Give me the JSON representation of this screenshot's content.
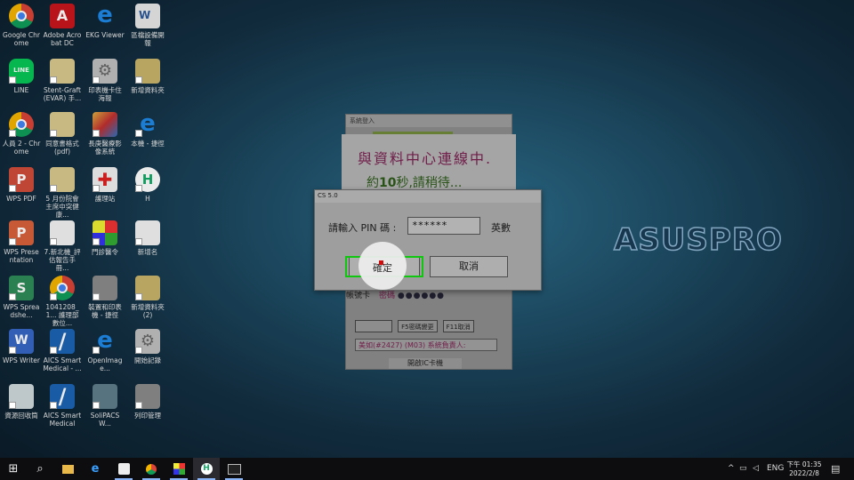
{
  "desktop_icons": [
    {
      "label": "Google Chrome",
      "glyph": "chrome-icon"
    },
    {
      "label": "Adobe Acrobat DC",
      "glyph": "adobe-icon"
    },
    {
      "label": "EKG Viewer",
      "glyph": "ie-icon"
    },
    {
      "label": "區檔設備開報",
      "glyph": "word-icon"
    },
    {
      "label": "LINE",
      "glyph": "line-icon"
    },
    {
      "label": "Stent-Graft (EVAR) 手...",
      "glyph": "file-icon"
    },
    {
      "label": "印表機卡住海報",
      "glyph": "gear-icon"
    },
    {
      "label": "新增資料夾",
      "glyph": "folder-icon"
    },
    {
      "label": "人員 2 - Chrome",
      "glyph": "chrome-icon"
    },
    {
      "label": "同意書格式 (pdf)",
      "glyph": "file-icon"
    },
    {
      "label": "長庚醫療影像系統",
      "glyph": "photo-icon"
    },
    {
      "label": "本機 - 捷徑",
      "glyph": "computer-icon"
    },
    {
      "label": "WPS PDF",
      "glyph": "pdf-icon"
    },
    {
      "label": "5 月份院會主席中突健康...",
      "glyph": "file-icon"
    },
    {
      "label": "護理站",
      "glyph": "redcross-icon"
    },
    {
      "label": "H",
      "glyph": "h-icon"
    },
    {
      "label": "WPS Presentation",
      "glyph": "wps-presentation-icon"
    },
    {
      "label": "7.新北機_評估報告手冊...",
      "glyph": "doc-icon"
    },
    {
      "label": "門診醫令",
      "glyph": "colors-icon"
    },
    {
      "label": "新增名",
      "glyph": "doc-icon"
    },
    {
      "label": "WPS Spreadshe...",
      "glyph": "wps-spreadsheet-icon"
    },
    {
      "label": "1041208_1... 護理部數位...",
      "glyph": "chrome-icon"
    },
    {
      "label": "裝置和印表機 - 捷徑",
      "glyph": "printer-icon"
    },
    {
      "label": "新增資料夾 (2)",
      "glyph": "folder-icon"
    },
    {
      "label": "WPS Writer",
      "glyph": "wps-writer-icon"
    },
    {
      "label": "AICS Smart Medical - ...",
      "glyph": "aics-icon"
    },
    {
      "label": "OpenImage...",
      "glyph": "ie-icon"
    },
    {
      "label": "開始記錄",
      "glyph": "gear-icon"
    },
    {
      "label": "資源回收筒",
      "glyph": "recycle-bin-icon"
    },
    {
      "label": "AICS Smart Medical",
      "glyph": "aics-icon"
    },
    {
      "label": "SoliPACSW...",
      "glyph": "pacs-icon"
    },
    {
      "label": "列印管理",
      "glyph": "printer-icon"
    }
  ],
  "brand_text": "ASUSPRO",
  "background_window": {
    "title": "系統登入",
    "connecting": "與資料中心連線中.",
    "wait_prefix": "約",
    "wait_seconds": "10",
    "wait_suffix": "秒,請稍待...",
    "account_label": "帳號卡",
    "password_label": "密碼",
    "password_dots": "●●●●●●",
    "btn_f5": "F5密碼變更",
    "btn_f11": "F11取消",
    "info_text": "美如(#2427) (M03) 系統負責人:",
    "ic_card_button": "開啟IC卡機"
  },
  "pin_dialog": {
    "title": "CS 5.0",
    "pin_label": "請輸入 PIN 碼 :",
    "pin_value": "******",
    "input_mode": "英數",
    "ok_label": "確定",
    "cancel_label": "取消"
  },
  "taskbar": {
    "items": [
      "windows-start-icon",
      "search-icon",
      "file-explorer-icon",
      "edge-icon",
      "app-icon",
      "chrome-icon",
      "medical-app-icon",
      "h-app-icon",
      "terminal-icon"
    ],
    "language": "ENG",
    "time": "下午 01:35",
    "date": "2022/2/8"
  }
}
